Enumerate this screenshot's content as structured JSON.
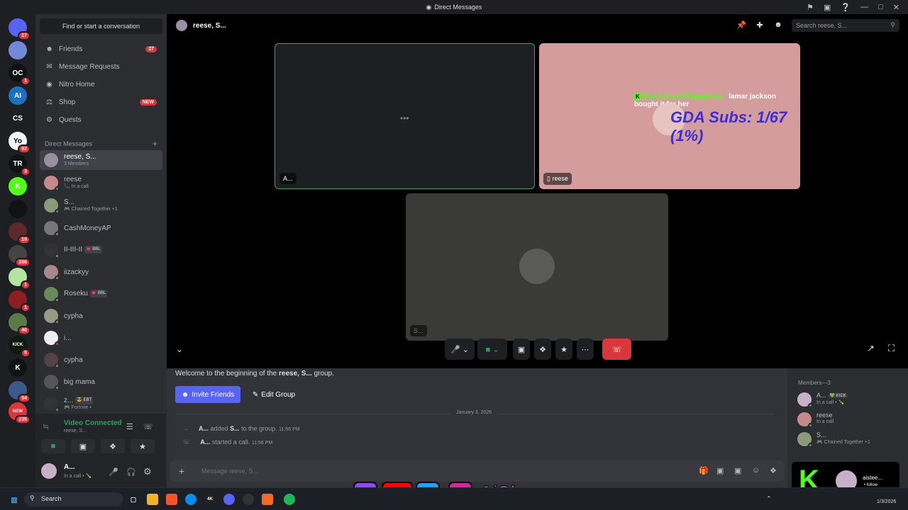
{
  "window": {
    "title": "Direct Messages"
  },
  "servers": [
    {
      "label": "",
      "badge": "27",
      "color": "#5865f2",
      "icon": "discord-home-icon"
    },
    {
      "label": "",
      "badge": "",
      "color": "#7289da",
      "icon": "server-avatar-icon"
    },
    {
      "label": "OC",
      "badge": "1",
      "color": "#111214",
      "icon": "server-oc-icon"
    },
    {
      "label": "AI",
      "badge": "",
      "color": "#1d6fbf",
      "icon": "server-ai-icon"
    },
    {
      "label": "CS",
      "badge": "",
      "color": "#1e1f22",
      "icon": "server-cs-icon"
    },
    {
      "label": "Yo",
      "badge": "92",
      "color": "#f2f3f5",
      "icon": "server-yo-icon"
    },
    {
      "label": "TR",
      "badge": "3",
      "color": "#111214",
      "icon": "server-tr-icon"
    },
    {
      "label": "K",
      "badge": "",
      "color": "#53fc18",
      "icon": "server-kick-icon"
    },
    {
      "label": "",
      "badge": "",
      "color": "#111214",
      "icon": "server-grid-icon"
    },
    {
      "label": "",
      "badge": "19",
      "color": "#5c2a2a",
      "icon": "server-img-icon"
    },
    {
      "label": "",
      "badge": "286",
      "color": "#444",
      "icon": "server-img-icon"
    },
    {
      "label": "",
      "badge": "1",
      "color": "#b5e3a0",
      "icon": "server-img-icon"
    },
    {
      "label": "",
      "badge": "1",
      "color": "#8b1e1e",
      "icon": "server-img-icon"
    },
    {
      "label": "",
      "badge": "40",
      "color": "#5a7a4a",
      "icon": "server-img-icon"
    },
    {
      "label": "KICK",
      "badge": "5",
      "color": "#0d1a0d",
      "icon": "server-kick2-icon"
    },
    {
      "label": "K",
      "badge": "",
      "color": "#111214",
      "icon": "server-kick3-icon"
    },
    {
      "label": "",
      "badge": "94",
      "color": "#3a5b8a",
      "icon": "server-img-icon"
    },
    {
      "label": "NEW",
      "badge": "235",
      "color": "#da373c",
      "icon": "server-new-icon"
    }
  ],
  "sidebar": {
    "search_label": "Find or start a conversation",
    "nav": [
      {
        "label": "Friends",
        "badge": "27",
        "icon": "friends-icon"
      },
      {
        "label": "Message Requests",
        "badge": "",
        "icon": "mail-icon"
      },
      {
        "label": "Nitro Home",
        "badge": "",
        "icon": "nitro-icon"
      },
      {
        "label": "Shop",
        "badge": "NEW",
        "icon": "shop-icon"
      },
      {
        "label": "Quests",
        "badge": "",
        "icon": "quests-icon"
      }
    ],
    "dm_header": "Direct Messages",
    "dms": [
      {
        "name": "reese, S...",
        "sub": "3 Members",
        "pill": "",
        "color": "#9a8fa0",
        "status": ""
      },
      {
        "name": "reese",
        "sub": "📞 In a call",
        "pill": "",
        "color": "#c78a8a",
        "status": "#23a55a"
      },
      {
        "name": "S...",
        "sub": "🎮 Chained Together +1",
        "pill": "",
        "color": "#8a9a7a",
        "status": "#23a55a"
      },
      {
        "name": "CashMoneyAP",
        "sub": "",
        "pill": "",
        "color": "#777",
        "status": "#80848e"
      },
      {
        "name": "II-III-II",
        "sub": "",
        "pill": "💗 BBL",
        "color": "#333",
        "status": "#80848e"
      },
      {
        "name": "iizackyy",
        "sub": "",
        "pill": "",
        "color": "#a88",
        "status": "#80848e"
      },
      {
        "name": "Roseku",
        "sub": "",
        "pill": "💗 BBL",
        "color": "#6a8a5a",
        "status": "#80848e"
      },
      {
        "name": "cypha",
        "sub": "",
        "pill": "",
        "color": "#998",
        "status": "#80848e"
      },
      {
        "name": "i...",
        "sub": "",
        "pill": "",
        "color": "#eee",
        "status": "#da373c"
      },
      {
        "name": "cypha",
        "sub": "",
        "pill": "",
        "color": "#544",
        "status": "#80848e"
      },
      {
        "name": "big mama",
        "sub": "",
        "pill": "",
        "color": "#555",
        "status": "#80848e"
      },
      {
        "name": "z...",
        "sub": "🎮 Fortnite •",
        "pill": "😎 EBT",
        "color": "#333",
        "status": "#23a55a"
      }
    ]
  },
  "voice": {
    "status": "Video Connected",
    "channel": "reese, S...",
    "user_name": "A...",
    "user_status": "In a call • 🍾"
  },
  "call": {
    "header_title": "reese, S...",
    "search_placeholder": "Search reese, S...",
    "tile1_label": "A...",
    "tile2_label": "reese",
    "tile3_label": "S...",
    "overlay_user": "BlackJewishRepublican",
    "overlay_msg": "lamar jackson bought it for her",
    "overlay_subs": "GDA Subs: 1/67 (1%)"
  },
  "chat": {
    "welcome_prefix": "Welcome to the beginning of the ",
    "welcome_group": "reese, S...",
    "welcome_suffix": " group.",
    "invite_label": "Invite Friends",
    "edit_label": "Edit Group",
    "date": "January 3, 2026",
    "events": [
      {
        "actor": "A...",
        "action": "added",
        "target": "S...",
        "rest": "to the group.",
        "time": "11:56 PM",
        "icon": "arrow-right-icon"
      },
      {
        "actor": "A...",
        "action": "started a call.",
        "target": "",
        "rest": "",
        "time": "11:56 PM",
        "icon": "phone-icon"
      }
    ],
    "input_placeholder": "Message reese, S..."
  },
  "members": {
    "header": "Members—3",
    "list": [
      {
        "name": "A...",
        "pill": "💚 KICK",
        "sub": "In a call • 🍾",
        "color": "#c8b0c8"
      },
      {
        "name": "reese",
        "pill": "",
        "sub": "In a call",
        "color": "#c78a8a"
      },
      {
        "name": "S...",
        "pill": "",
        "sub": "🎮 Chained Together +1",
        "color": "#8a9a7a"
      }
    ]
  },
  "stream_overlay": {
    "handle": "AiSleezo",
    "kick_name": "aistee...",
    "kick_sub": "• follow"
  },
  "taskbar": {
    "search_label": "Search",
    "date": "1/3/2026"
  }
}
